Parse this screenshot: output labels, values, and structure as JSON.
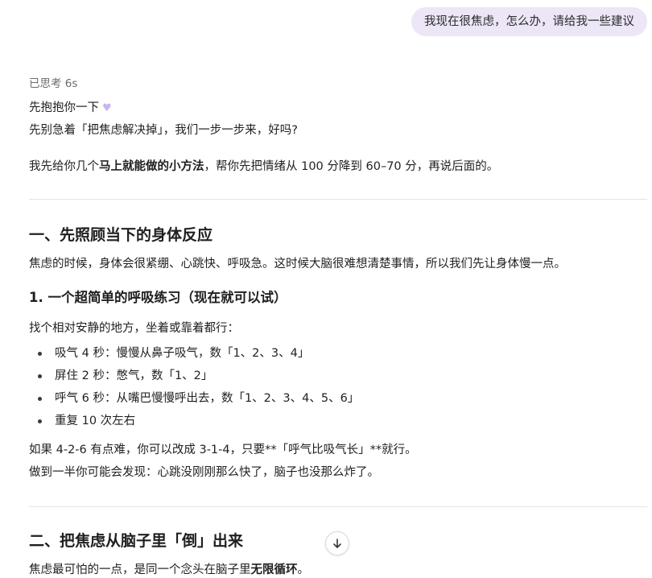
{
  "user_message": "我现在很焦虑，怎么办，请给我一些建议",
  "thought_label": "已思考 6s",
  "intro": {
    "line1": "先抱抱你一下",
    "line2": "先别急着「把焦虑解决掉」，我们一步一步来，好吗?",
    "line3_a": "我先给你几个",
    "line3_bold": "马上就能做的小方法",
    "line3_b": "，帮你先把情绪从 100 分降到 60–70 分，再说后面的。"
  },
  "section1": {
    "title": "一、先照顾当下的身体反应",
    "desc": "焦虑的时候，身体会很紧绷、心跳快、呼吸急。这时候大脑很难想清楚事情，所以我们先让身体慢一点。",
    "sub_title": "1. 一个超简单的呼吸练习（现在就可以试）",
    "sub_desc": "找个相对安静的地方，坐着或靠着都行：",
    "steps": [
      "吸气 4 秒：慢慢从鼻子吸气，数「1、2、3、4」",
      "屏住 2 秒：憋气，数「1、2」",
      "呼气 6 秒：从嘴巴慢慢呼出去，数「1、2、3、4、5、6」",
      "重复 10 次左右"
    ],
    "note1": "如果 4-2-6 有点难，你可以改成 3-1-4，只要**「呼气比吸气长」**就行。",
    "note2": "做到一半你可能会发现：心跳没刚刚那么快了，脑子也没那么炸了。"
  },
  "section2": {
    "title": "二、把焦虑从脑子里「倒」出来",
    "desc_a": "焦虑最可怕的一点，是同一个念头在脑子里",
    "desc_bold": "无限循环",
    "desc_b": "。"
  },
  "icons": {
    "heart": "heart-icon",
    "scroll_down": "arrow-down-icon"
  }
}
